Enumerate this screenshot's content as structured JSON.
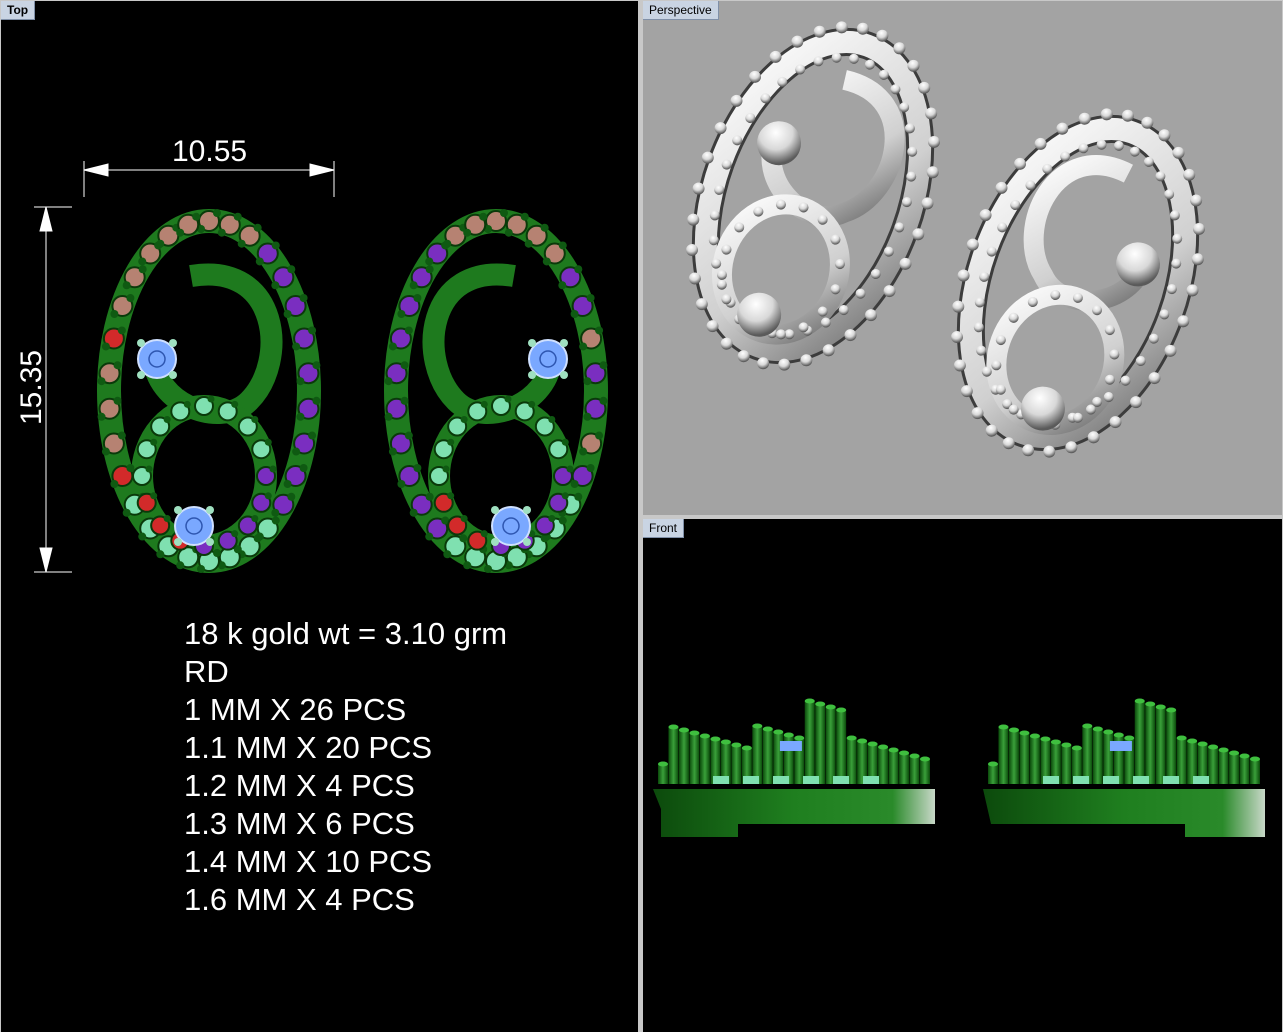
{
  "viewports": {
    "top": {
      "label": "Top"
    },
    "perspective": {
      "label": "Perspective"
    },
    "front": {
      "label": "Front"
    }
  },
  "dimensions": {
    "width": "10.55",
    "height": "15.35"
  },
  "specs": {
    "gold_weight": "18 k gold wt = 3.10 grm",
    "shape": "RD",
    "stones": [
      "1 MM X 26 PCS",
      "1.1 MM X 20 PCS",
      "1.2 MM X 4 PCS",
      "1.3 MM X 6 PCS",
      "1.4 MM X 10 PCS",
      "1.6 MM X 4 PCS"
    ]
  },
  "colors": {
    "metal": "#1e7a1e",
    "prong": "#0f5a12",
    "pink_stone": "#b68272",
    "red_stone": "#d22a2a",
    "purple_stone": "#7a2ec0",
    "mint_stone": "#7fe0b0",
    "blue_stone": "#7aa8ff",
    "persp_bg": "#a3a3a3"
  }
}
